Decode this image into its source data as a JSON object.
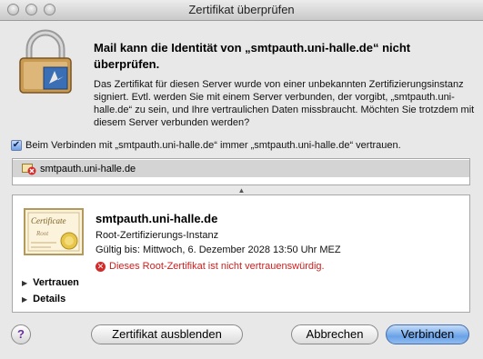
{
  "window": {
    "title": "Zertifikat überprüfen"
  },
  "header": {
    "heading": "Mail kann die Identität von „smtpauth.uni-halle.de“ nicht überprüfen.",
    "description": "Das Zertifikat für diesen Server wurde von einer unbekannten Zertifizierungsinstanz signiert. Evtl. werden Sie mit einem Server verbunden, der vorgibt, „smtpauth.uni-halle.de“ zu sein, und Ihre vertraulichen Daten missbraucht. Möchten Sie trotzdem mit diesem Server verbunden werden?"
  },
  "trust_checkbox": {
    "checked": true,
    "label": "Beim Verbinden mit „smtpauth.uni-halle.de“ immer „smtpauth.uni-halle.de“ vertrauen."
  },
  "chain": {
    "items": [
      {
        "label": "smtpauth.uni-halle.de"
      }
    ]
  },
  "certificate": {
    "name": "smtpauth.uni-halle.de",
    "type": "Root-Zertifizierungs-Instanz",
    "validity": "Gültig bis: Mittwoch, 6. Dezember 2028 13:50 Uhr MEZ",
    "error": "Dieses Root-Zertifikat ist nicht vertrauenswürdig.",
    "image_text": "Certificate",
    "image_subtext": "Root"
  },
  "sections": {
    "trust": "Vertrauen",
    "details": "Details"
  },
  "buttons": {
    "help": "?",
    "hide_certificate": "Zertifikat ausblenden",
    "cancel": "Abbrechen",
    "connect": "Verbinden"
  },
  "colors": {
    "error": "#cc1f1f",
    "default_button": "#6aa3e8"
  }
}
